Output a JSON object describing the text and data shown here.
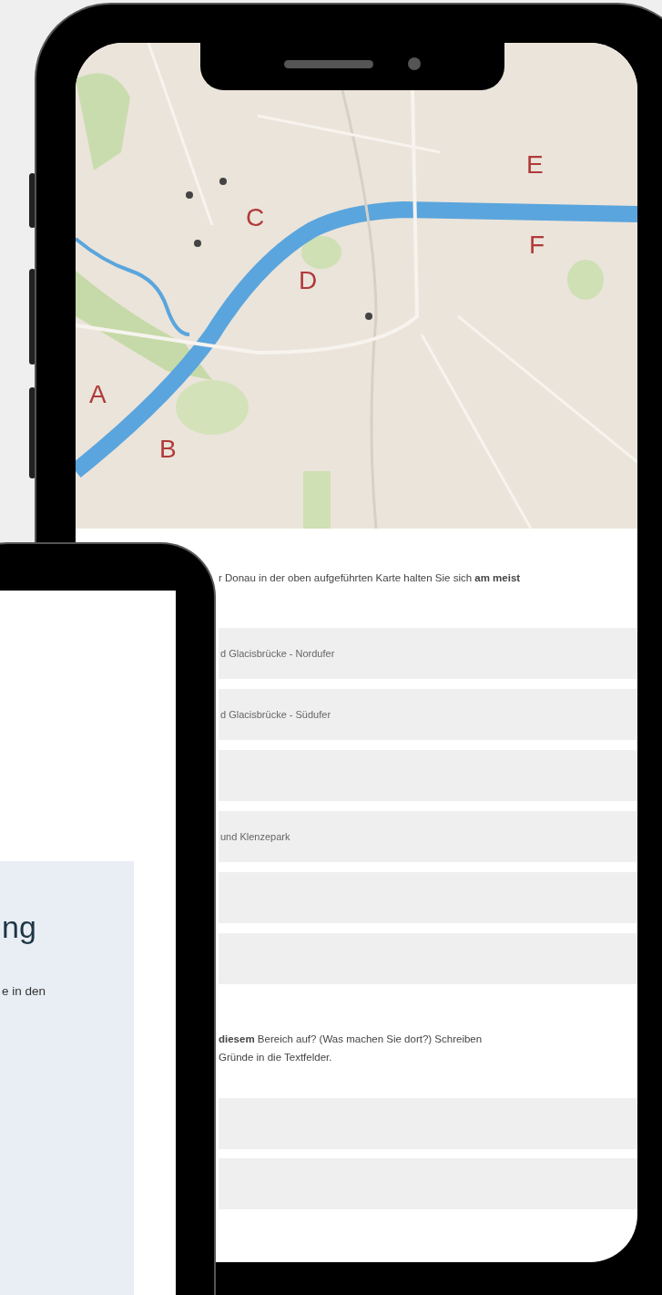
{
  "map": {
    "labels": [
      {
        "text": "A"
      },
      {
        "text": "B"
      },
      {
        "text": "C"
      },
      {
        "text": "D"
      },
      {
        "text": "E"
      },
      {
        "text": "F"
      }
    ]
  },
  "question_1": {
    "text": "r Donau in der oben aufgeführten Karte halten Sie sich **am meist**"
  },
  "options": [
    {
      "kind": "option",
      "label": "d Glacisbrücke - Nordufer"
    },
    {
      "kind": "option",
      "label": "d Glacisbrücke - Südufer"
    },
    {
      "kind": "option"
    },
    {
      "kind": "option",
      "label": "und Klenzepark"
    },
    {
      "kind": "option"
    },
    {
      "kind": "option"
    }
  ],
  "question_2": {
    "lines": [
      "**diesem** Bereich auf? (Was machen Sie dort?) Schreiben",
      "Gründe in die Textfelder."
    ]
  },
  "text_fields": [
    {
      "kind": "text"
    },
    {
      "kind": "text"
    }
  ],
  "second_phone": {
    "heading": "ng",
    "text": "e in den"
  }
}
